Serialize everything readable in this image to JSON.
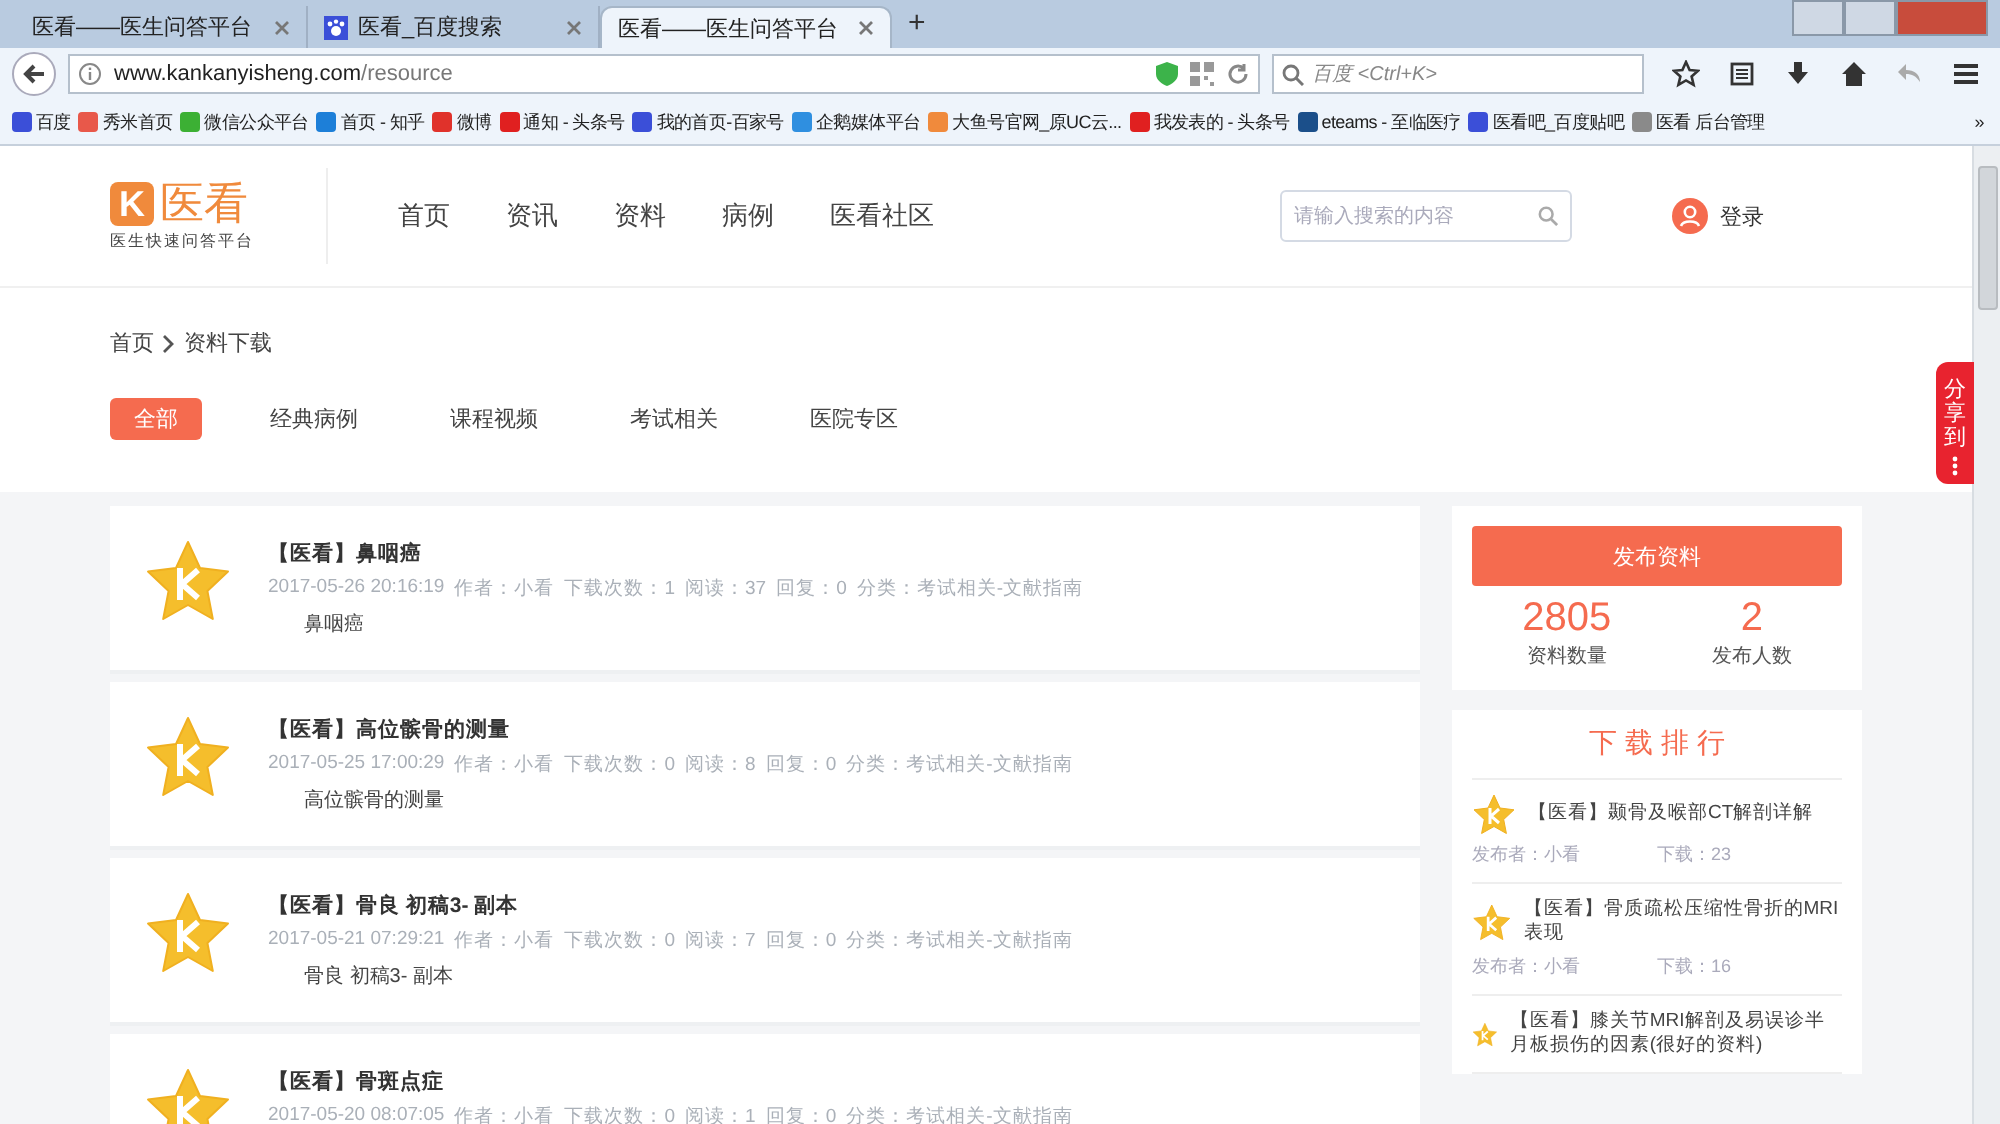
{
  "browser": {
    "tabs": [
      {
        "title": "医看——医生问答平台",
        "selected": false,
        "has_icon": false
      },
      {
        "title": "医看_百度搜索",
        "selected": false,
        "has_icon": true
      },
      {
        "title": "医看——医生问答平台",
        "selected": true,
        "has_icon": false
      }
    ],
    "new_tab": "+",
    "url_host": "www.kankanyisheng.com",
    "url_path": "/resource",
    "search_placeholder": "百度 <Ctrl+K>",
    "bookmarks": [
      {
        "label": "百度",
        "color": "#3b4fd8"
      },
      {
        "label": "秀米首页",
        "color": "#e8584a"
      },
      {
        "label": "微信公众平台",
        "color": "#3cb034"
      },
      {
        "label": "首页 - 知乎",
        "color": "#1d7fd8"
      },
      {
        "label": "微博",
        "color": "#e0322b"
      },
      {
        "label": "通知 - 头条号",
        "color": "#e02020"
      },
      {
        "label": "我的首页-百家号",
        "color": "#3b4fd8"
      },
      {
        "label": "企鹅媒体平台",
        "color": "#2f8fe0"
      },
      {
        "label": "大鱼号官网_原UC云...",
        "color": "#f08a3c"
      },
      {
        "label": "我发表的 - 头条号",
        "color": "#e02020"
      },
      {
        "label": "eteams - 至临医疗",
        "color": "#1b4f8a"
      },
      {
        "label": "医看吧_百度贴吧",
        "color": "#3b4fd8"
      },
      {
        "label": "医看 后台管理",
        "color": "#8a8a8a"
      }
    ],
    "more": "»"
  },
  "site": {
    "logo_mark": "K",
    "logo_text": "医看",
    "tagline": "医生快速问答平台",
    "nav": [
      "首页",
      "资讯",
      "资料",
      "病例",
      "医看社区"
    ],
    "search_placeholder": "请输入搜索的内容",
    "login": "登录"
  },
  "breadcrumb": [
    "首页",
    "资料下载"
  ],
  "filters": [
    {
      "label": "全部",
      "selected": true
    },
    {
      "label": "经典病例",
      "selected": false
    },
    {
      "label": "课程视频",
      "selected": false
    },
    {
      "label": "考试相关",
      "selected": false
    },
    {
      "label": "医院专区",
      "selected": false
    }
  ],
  "resources": [
    {
      "title": "【医看】鼻咽癌",
      "meta": [
        "2017-05-26 20:16:19",
        "作者：小看",
        "下载次数：1",
        "阅读：37",
        "回复：0",
        "分类：考试相关-文献指南"
      ],
      "body": "鼻咽癌"
    },
    {
      "title": "【医看】高位髌骨的测量",
      "meta": [
        "2017-05-25 17:00:29",
        "作者：小看",
        "下载次数：0",
        "阅读：8",
        "回复：0",
        "分类：考试相关-文献指南"
      ],
      "body": "高位髌骨的测量"
    },
    {
      "title": "【医看】骨良 初稿3- 副本",
      "meta": [
        "2017-05-21 07:29:21",
        "作者：小看",
        "下载次数：0",
        "阅读：7",
        "回复：0",
        "分类：考试相关-文献指南"
      ],
      "body": "骨良 初稿3- 副本"
    },
    {
      "title": "【医看】骨斑点症",
      "meta": [
        "2017-05-20 08:07:05",
        "作者：小看",
        "下载次数：0",
        "阅读：1",
        "回复：0",
        "分类：考试相关-文献指南"
      ]
    }
  ],
  "sidebar": {
    "publish_button": "发布资料",
    "stats": [
      {
        "value": "2805",
        "label": "资料数量"
      },
      {
        "value": "2",
        "label": "发布人数"
      }
    ],
    "ranking_title": "下 载 排 行",
    "ranking": [
      {
        "title": "【医看】颞骨及喉部CT解剖详解",
        "publisher": "发布者：小看",
        "downloads": "下载：23"
      },
      {
        "title": "【医看】骨质疏松压缩性骨折的MRI表现",
        "publisher": "发布者：小看",
        "downloads": "下载：16"
      },
      {
        "title": "【医看】膝关节MRI解剖及易误诊半月板损伤的因素(很好的资料)"
      }
    ]
  },
  "share": {
    "label": "分享到"
  }
}
